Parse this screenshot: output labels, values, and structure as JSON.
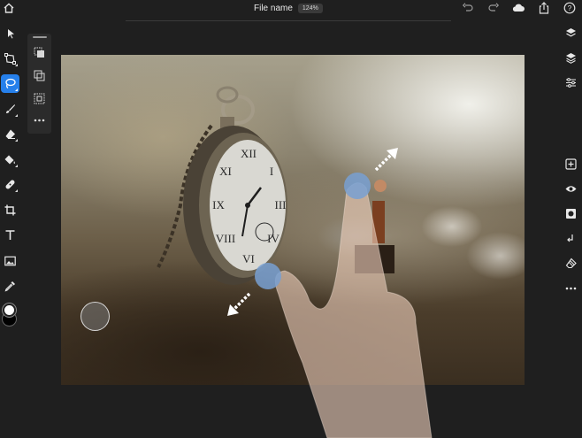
{
  "window": {
    "file_name": "File name",
    "zoom_level": "124%"
  },
  "top_icons": [
    "home-icon",
    "undo-icon",
    "redo-icon",
    "cloud-icon",
    "share-icon",
    "help-icon"
  ],
  "left_tools": [
    {
      "name": "move-tool",
      "icon": "arrow-cursor-icon",
      "active": false
    },
    {
      "name": "transform-tool",
      "icon": "transform-icon",
      "active": false
    },
    {
      "name": "lasso-tool",
      "icon": "lasso-icon",
      "active": true
    },
    {
      "name": "brush-tool",
      "icon": "brush-icon",
      "active": false
    },
    {
      "name": "eraser-tool",
      "icon": "eraser-icon",
      "active": false
    },
    {
      "name": "fill-tool",
      "icon": "paint-bucket-icon",
      "active": false
    },
    {
      "name": "healing-tool",
      "icon": "bandage-icon",
      "active": false
    },
    {
      "name": "crop-tool",
      "icon": "crop-icon",
      "active": false
    },
    {
      "name": "type-tool",
      "icon": "type-icon",
      "active": false
    },
    {
      "name": "place-image-tool",
      "icon": "image-icon",
      "active": false
    },
    {
      "name": "eyedropper-tool",
      "icon": "eyedropper-icon",
      "active": false
    }
  ],
  "colors": {
    "foreground": "#ffffff",
    "background": "#000000",
    "accent": "#2680eb"
  },
  "tool_options": [
    "new-selection-icon",
    "add-selection-icon",
    "subtract-selection-icon",
    "more-options-icon"
  ],
  "right_tools": [
    "layers-icon",
    "layer-properties-icon",
    "adjustments-icon",
    "add-layer-icon",
    "visibility-icon",
    "mask-icon",
    "clipping-icon",
    "eraser-layer-icon",
    "more-icon"
  ]
}
